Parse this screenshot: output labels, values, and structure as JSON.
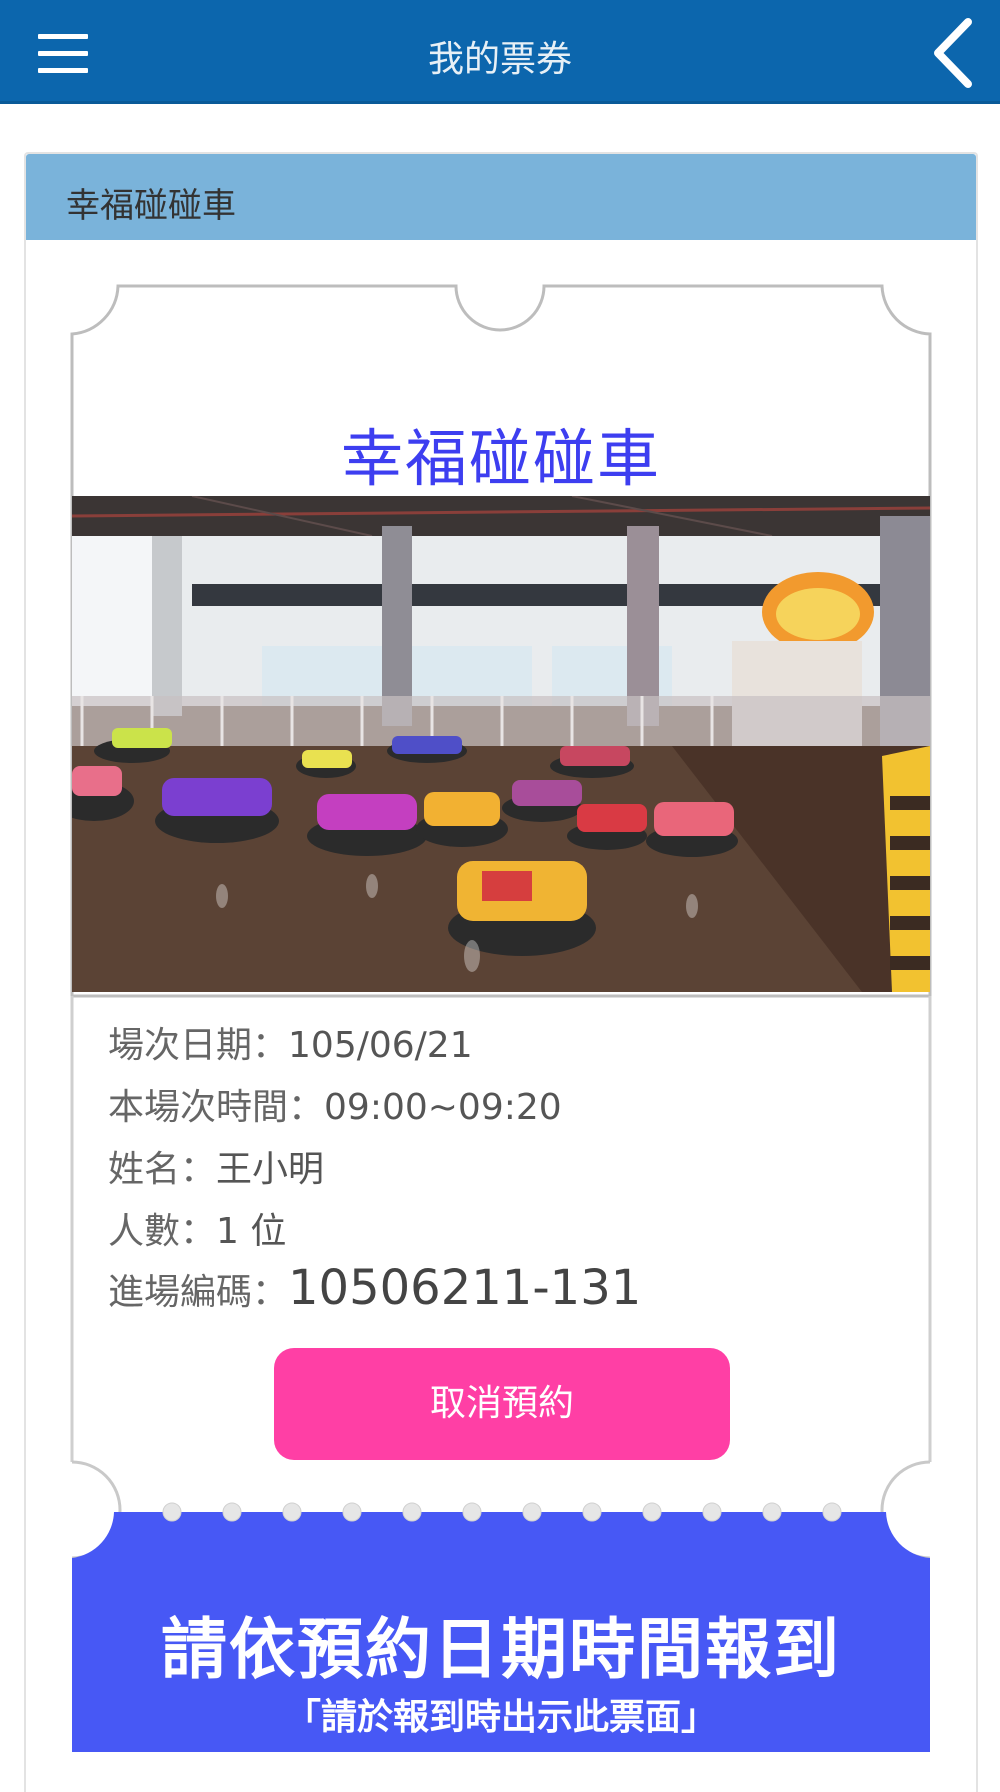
{
  "header": {
    "title": "我的票券",
    "menu_icon": "hamburger-menu-icon",
    "back_icon": "chevron-left-icon"
  },
  "card": {
    "heading": "幸福碰碰車"
  },
  "ticket": {
    "title": "幸福碰碰車",
    "photo_alt": "bumper-car-arena-photo",
    "info": {
      "date_label": "場次日期：",
      "date_value": "105/06/21",
      "time_label": "本場次時間：",
      "time_value": "09:00~09:20",
      "name_label": "姓名：",
      "name_value": "王小明",
      "count_label": "人數：",
      "count_value": "1 位",
      "code_label": "進場編碼：",
      "code_value": "10506211-131"
    },
    "cancel_label": "取消預約",
    "notice_main": "請依預約日期時間報到",
    "notice_sub": "「請於報到時出示此票面」"
  },
  "colors": {
    "header_bg": "#0c66ad",
    "card_heading_bg": "#7ab3da",
    "ticket_title": "#3d3ef0",
    "cancel_button": "#ff3fa5",
    "stub_bg": "#4758f5"
  }
}
